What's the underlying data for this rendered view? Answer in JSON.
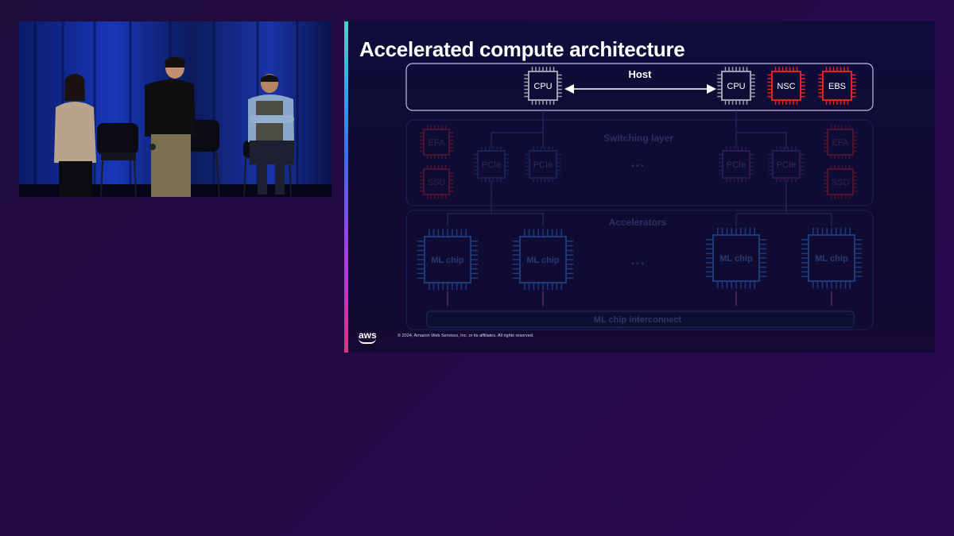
{
  "slide": {
    "title": "Accelerated compute architecture",
    "host": {
      "label": "Host",
      "chips": [
        "CPU",
        "CPU",
        "NSC",
        "EBS"
      ]
    },
    "switching_layer": {
      "label": "Switching layer",
      "left_side": [
        "EFA",
        "SSD"
      ],
      "right_side": [
        "EFA",
        "SSD"
      ],
      "pcie": [
        "PCIe",
        "PCIe",
        "PCIe",
        "PCIe"
      ],
      "ellipsis": "• • •"
    },
    "accelerators": {
      "label": "Accelerators",
      "chips": [
        "ML chip",
        "ML chip",
        "ML chip",
        "ML chip"
      ],
      "ellipsis": "• • •"
    },
    "interconnect": {
      "label": "ML chip interconnect"
    },
    "footer": {
      "logo": "aws",
      "copyright": "© 2024, Amazon Web Services, Inc. or its affiliates. All rights reserved."
    }
  },
  "colors": {
    "host_chip": "#9aa0ae",
    "highlight_chip": "#e0251c",
    "dim_blue": "#1f3a7a",
    "dim_red": "#4a1530",
    "accent_gradient": [
      "#33e0c8",
      "#3b6cff",
      "#a53cf0",
      "#e0337e"
    ]
  }
}
